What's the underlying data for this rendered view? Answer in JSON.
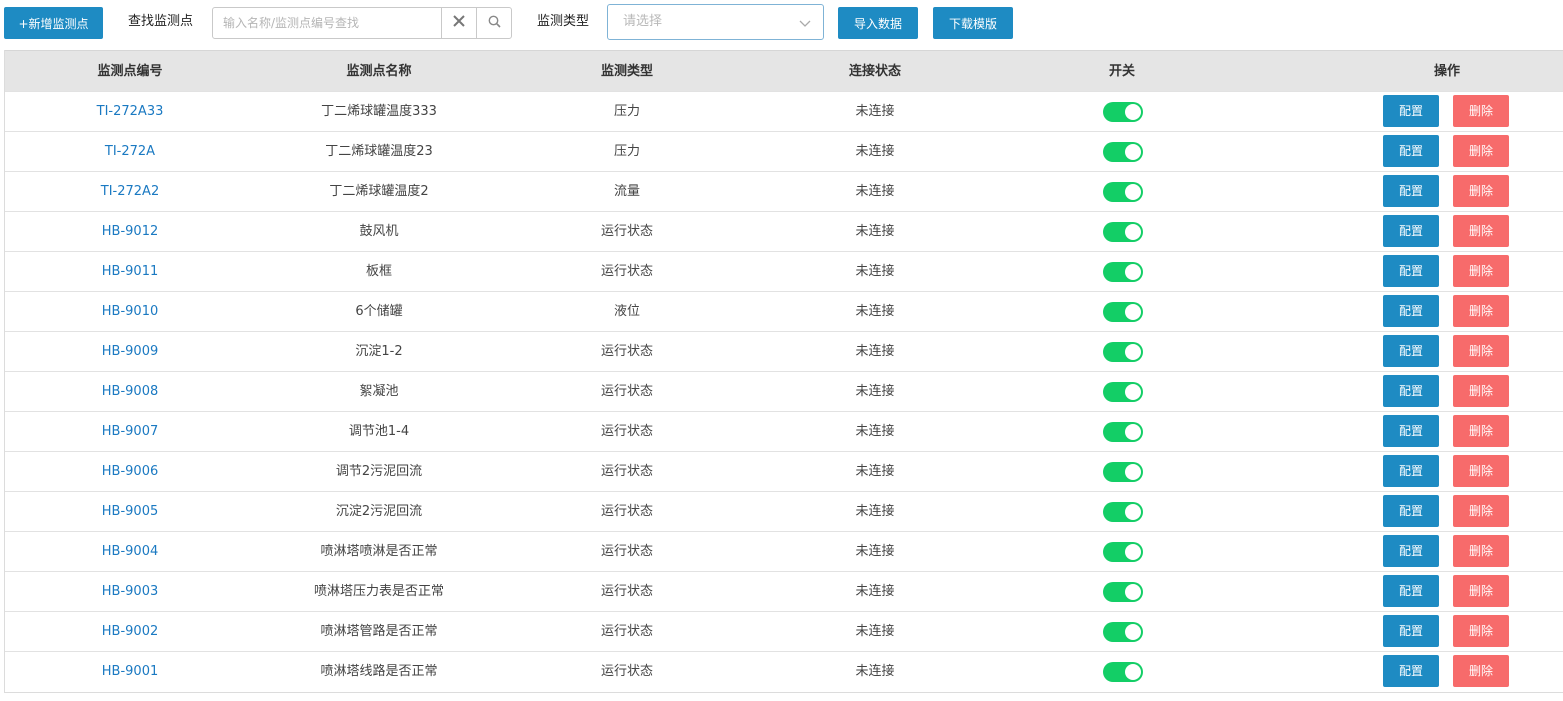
{
  "toolbar": {
    "add_label": "+新增监测点",
    "search_label": "查找监测点",
    "search_placeholder": "输入名称/监测点编号查找",
    "search_value": "",
    "type_label": "监测类型",
    "type_placeholder": "请选择",
    "import_label": "导入数据",
    "download_label": "下载模版"
  },
  "icons": {
    "clear": "close-icon",
    "search": "search-icon",
    "dropdown": "chevron-down-icon"
  },
  "colors": {
    "primary": "#1e8bc3",
    "danger": "#f76b6b",
    "link": "#1a79c2",
    "switch_on": "#13ce66"
  },
  "table": {
    "headers": [
      "监测点编号",
      "监测点名称",
      "监测类型",
      "连接状态",
      "开关",
      "操作"
    ],
    "config_label": "配置",
    "delete_label": "删除",
    "rows": [
      {
        "code": "TI-272A33",
        "name": "丁二烯球罐温度333",
        "type": "压力",
        "status": "未连接",
        "switch_on": true
      },
      {
        "code": "TI-272A",
        "name": "丁二烯球罐温度23",
        "type": "压力",
        "status": "未连接",
        "switch_on": true
      },
      {
        "code": "TI-272A2",
        "name": "丁二烯球罐温度2",
        "type": "流量",
        "status": "未连接",
        "switch_on": true
      },
      {
        "code": "HB-9012",
        "name": "鼓风机",
        "type": "运行状态",
        "status": "未连接",
        "switch_on": true
      },
      {
        "code": "HB-9011",
        "name": "板框",
        "type": "运行状态",
        "status": "未连接",
        "switch_on": true
      },
      {
        "code": "HB-9010",
        "name": "6个储罐",
        "type": "液位",
        "status": "未连接",
        "switch_on": true
      },
      {
        "code": "HB-9009",
        "name": "沉淀1-2",
        "type": "运行状态",
        "status": "未连接",
        "switch_on": true
      },
      {
        "code": "HB-9008",
        "name": "絮凝池",
        "type": "运行状态",
        "status": "未连接",
        "switch_on": true
      },
      {
        "code": "HB-9007",
        "name": "调节池1-4",
        "type": "运行状态",
        "status": "未连接",
        "switch_on": true
      },
      {
        "code": "HB-9006",
        "name": "调节2污泥回流",
        "type": "运行状态",
        "status": "未连接",
        "switch_on": true
      },
      {
        "code": "HB-9005",
        "name": "沉淀2污泥回流",
        "type": "运行状态",
        "status": "未连接",
        "switch_on": true
      },
      {
        "code": "HB-9004",
        "name": "喷淋塔喷淋是否正常",
        "type": "运行状态",
        "status": "未连接",
        "switch_on": true
      },
      {
        "code": "HB-9003",
        "name": "喷淋塔压力表是否正常",
        "type": "运行状态",
        "status": "未连接",
        "switch_on": true
      },
      {
        "code": "HB-9002",
        "name": "喷淋塔管路是否正常",
        "type": "运行状态",
        "status": "未连接",
        "switch_on": true
      },
      {
        "code": "HB-9001",
        "name": "喷淋塔线路是否正常",
        "type": "运行状态",
        "status": "未连接",
        "switch_on": true
      }
    ]
  }
}
